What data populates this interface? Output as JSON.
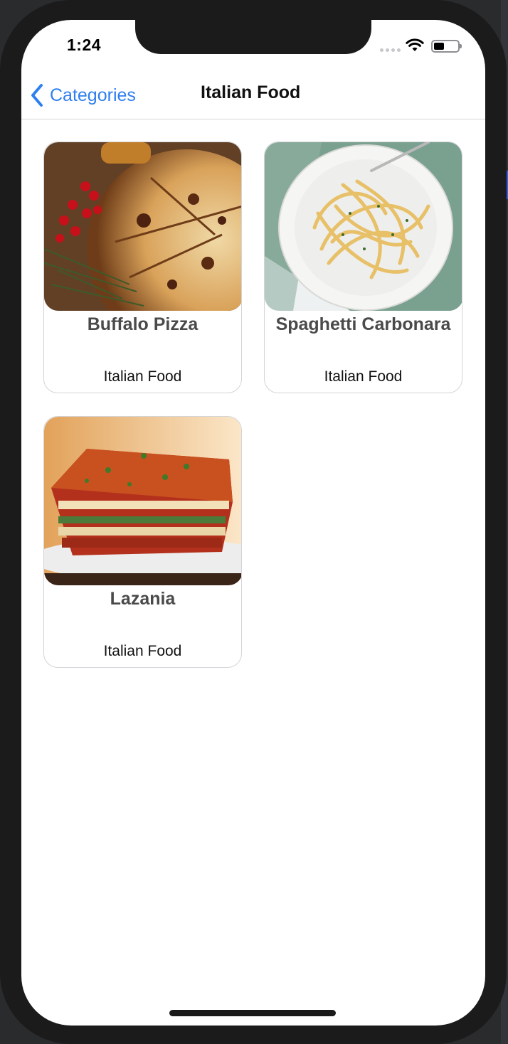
{
  "status_bar": {
    "time": "1:24"
  },
  "nav": {
    "back_label": "Categories",
    "title": "Italian Food"
  },
  "colors": {
    "accent": "#2f7ff0",
    "card_border": "#d4d4d8",
    "title_text": "#4a4a4a"
  },
  "items": [
    {
      "title": "Buffalo Pizza",
      "subtitle": "Italian Food",
      "image": "pizza-photo"
    },
    {
      "title": "Spaghetti Carbonara",
      "subtitle": "Italian Food",
      "image": "pasta-photo"
    },
    {
      "title": "Lazania",
      "subtitle": "Italian Food",
      "image": "lasagna-photo"
    }
  ]
}
